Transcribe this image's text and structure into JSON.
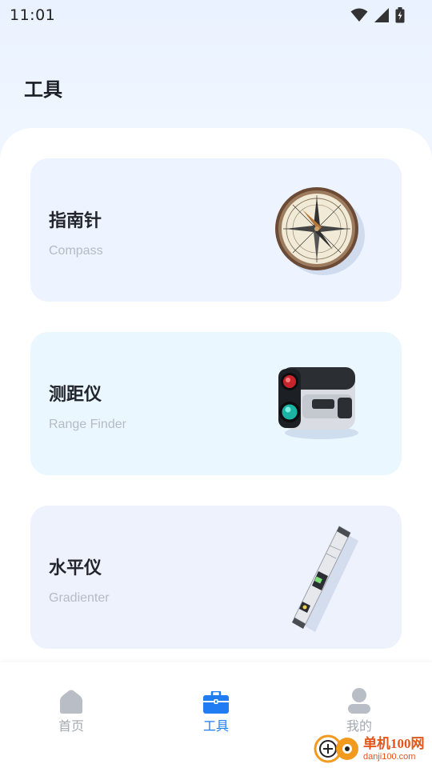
{
  "status_bar": {
    "time": "11:01",
    "icons": [
      "wifi-icon",
      "signal-icon",
      "battery-icon"
    ]
  },
  "header": {
    "title": "工具"
  },
  "tools": [
    {
      "title": "指南针",
      "subtitle": "Compass",
      "icon": "compass-image"
    },
    {
      "title": "测距仪",
      "subtitle": "Range Finder",
      "icon": "rangefinder-image"
    },
    {
      "title": "水平仪",
      "subtitle": "Gradienter",
      "icon": "spirit-level-image"
    }
  ],
  "bottom_nav": {
    "items": [
      {
        "label": "首页",
        "icon": "home-icon",
        "active": false
      },
      {
        "label": "工具",
        "icon": "toolbox-icon",
        "active": true
      },
      {
        "label": "我的",
        "icon": "user-icon",
        "active": false
      }
    ]
  },
  "watermark": {
    "title": "单机100网",
    "url": "danji100.com"
  },
  "colors": {
    "accent": "#1f7cf3",
    "inactive": "#a3a8b2",
    "card_compass": "#edf4ff",
    "card_range": "#ebf7ff",
    "card_level": "#eef2fd"
  }
}
